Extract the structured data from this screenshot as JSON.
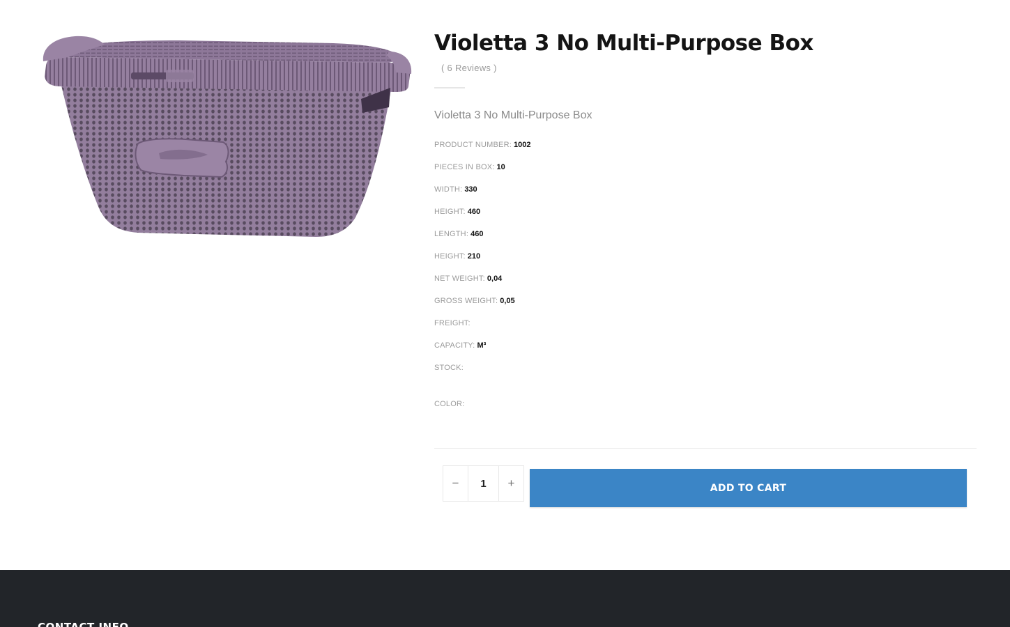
{
  "product": {
    "title": "Violetta 3 No Multi-Purpose Box",
    "reviews": "( 6 Reviews )",
    "subtitle": "Violetta 3 No Multi-Purpose Box",
    "image_color": "#8b7594"
  },
  "specs": [
    {
      "label": "PRODUCT NUMBER:",
      "value": "1002"
    },
    {
      "label": "PIECES IN BOX:",
      "value": "10"
    },
    {
      "label": "WIDTH:",
      "value": "330"
    },
    {
      "label": "HEIGHT:",
      "value": "460"
    },
    {
      "label": "LENGTH:",
      "value": "460"
    },
    {
      "label": "HEIGHT:",
      "value": "210"
    },
    {
      "label": "NET WEIGHT:",
      "value": "0,04"
    },
    {
      "label": "GROSS WEIGHT:",
      "value": "0,05"
    },
    {
      "label": "FREIGHT:",
      "value": ""
    },
    {
      "label": "CAPACITY:",
      "value": "M³"
    },
    {
      "label": "STOCK:",
      "value": ""
    }
  ],
  "color_label": "COLOR:",
  "cart": {
    "decrement": "−",
    "quantity": "1",
    "increment": "+",
    "add_to_cart": "ADD TO CART",
    "button_color": "#3b85c6"
  },
  "footer": {
    "heading": "CONTACT INFO",
    "background": "#222529"
  }
}
